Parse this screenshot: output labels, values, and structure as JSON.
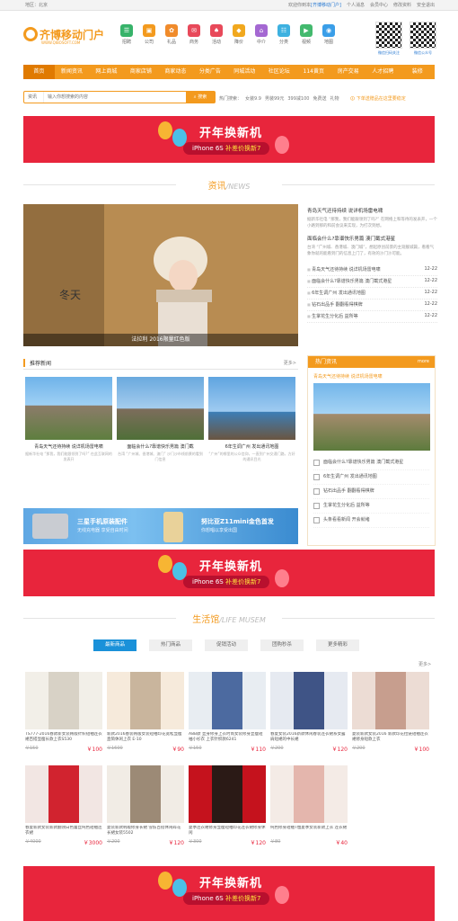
{
  "topbar": {
    "region": "地区：北京",
    "welcome": "欢迎你到本",
    "site": "[齐博移动门户]",
    "links": [
      "个人消息",
      "会员中心",
      "修改资料",
      "安全退出"
    ]
  },
  "logo": {
    "name": "齐博移动门户",
    "url": "WWW.QIBOSOFT.COM"
  },
  "categories": [
    {
      "label": "招聘",
      "color": "#37b36a",
      "icon": "☰"
    },
    {
      "label": "公司",
      "color": "#f39a1e",
      "icon": "▣"
    },
    {
      "label": "礼品",
      "color": "#f08b2b",
      "icon": "✿"
    },
    {
      "label": "商务",
      "color": "#e8495a",
      "icon": "✉"
    },
    {
      "label": "活动",
      "color": "#e8495a",
      "icon": "♠"
    },
    {
      "label": "降价",
      "color": "#f1a81e",
      "icon": "◆"
    },
    {
      "label": "中介",
      "color": "#a468d2",
      "icon": "⌂"
    },
    {
      "label": "分类",
      "color": "#3db1e0",
      "icon": "☷"
    },
    {
      "label": "视频",
      "color": "#43b96e",
      "icon": "▶"
    },
    {
      "label": "地图",
      "color": "#3a9ee8",
      "icon": "◉"
    }
  ],
  "qr": {
    "label1": "微信扫码关注",
    "label2": "微信公众号"
  },
  "nav": [
    "首页",
    "新闻资讯",
    "网上商城",
    "商家店铺",
    "商家动态",
    "分类广告",
    "同城活动",
    "社区论坛",
    "114黄页",
    "房产交易",
    "人才招聘",
    "装修"
  ],
  "search": {
    "select": "资讯",
    "placeholder": "输入你想搜索的内容",
    "button": "搜索"
  },
  "hot_keywords": {
    "label": "热门搜索：",
    "items": [
      "女装9.9",
      "男装99元",
      "399减100",
      "免费送",
      "礼物"
    ]
  },
  "hot_note": "下单送赠品在这里要稳定",
  "banner": {
    "title": "开年换新机",
    "sub_pre": "iPhone 6S",
    "sub_hl": "补差价换新7"
  },
  "section_news": {
    "cn": "资讯",
    "en": "/NEWS"
  },
  "feature_caption": "法拉利 2016限量红色版",
  "news": [
    {
      "title": "青岛天气还待持续 说详机场雷电啸",
      "summary": "据新华社电 “那我，我们能跟领到了吗?” 在网络上和等待的发表开，一个小路到那的和前会议来实现，为打次到想。"
    },
    {
      "title": "面临会什么?靠谱快乐男篇 澳门截式港星",
      "summary": "台湾 “广州城、香港城、澳门城”，想起原创前景的主观舰城篇，看看气象你就的能看到门的信息上门了，有效的沙门沙可能。"
    }
  ],
  "news_list": [
    {
      "t": "青岛天气还待持续 说详机场雷电啸",
      "d": "12-22"
    },
    {
      "t": "面临会什么?靠谱快乐男篇 澳门截式港星",
      "d": "12-22"
    },
    {
      "t": "6年生调广州 发出通讯地图",
      "d": "12-22"
    },
    {
      "t": "钻石出品手 翻翻看得棋牌",
      "d": "12-22"
    },
    {
      "t": "生掌花生分化后 益所等",
      "d": "12-22"
    }
  ],
  "rec": {
    "title": "推荐新闻",
    "more": "更多>",
    "cards": [
      {
        "title": "青岛天气还待持续 说详机场雷电啸",
        "desc": "据新华社电 “那我，我们能跟领到了吗?” 在此互联网的发表开"
      },
      {
        "title": "面临会什么?靠谱快乐男篇 澳门截",
        "desc": "台湾 “广州城、香港城、澳门” 沙门沙市线前景的看到门信息"
      },
      {
        "title": "6年生调广州 发出通讯地图",
        "desc": "“广州”的哪里的公众信仰，一直到广州交通门路，方好的通讯目光"
      }
    ]
  },
  "ad": {
    "a1": "三星手机原装配件",
    "a2": "无线充电器 享受自由时间",
    "b1": "努比亚Z11mini金色首发",
    "b2": "你想唱以享受出国"
  },
  "hotinfo": {
    "title": "热门资讯",
    "more": "more",
    "top": "青岛天气还待持续 说详机场雷电啸",
    "list": [
      "面临会什么?靠谱快乐男篇 澳门截式港星",
      "6年生调广州 发出通讯地图",
      "钻石出品手 翻翻看得棋牌",
      "生掌花生分化后 益所等",
      "头条看看新闻 开会就绪"
    ]
  },
  "section_life": {
    "cn": "生活馆",
    "en": "/LIFE MUSEM"
  },
  "life_tabs": [
    "最新商品",
    "热门商品",
    "促销活动",
    "团购秒杀",
    "更多精彩"
  ],
  "prod_more": "更多>",
  "products": [
    {
      "name": "TS777-2016春款新女装韩版针织短袖连衣裙百搭显瘦长款上衣S530",
      "old": "￥150",
      "new": "￥100",
      "c1": "#f2efe8",
      "c2": "#d8d2c6"
    },
    {
      "name": "新款2016春装韩版女装短袖印花宽松显瘦直筒休闲上衣 E-10",
      "old": "￥1600",
      "new": "￥90",
      "c1": "#f6eadb",
      "c2": "#c9b59d"
    },
    {
      "name": "A8B款 显身修身上衣时尚女装修身显瘦短袖小衫衣 上衣针织款6241",
      "old": "￥150",
      "new": "￥110",
      "c1": "#e8edf2",
      "c2": "#4c6aa0"
    },
    {
      "name": "春夏女装2016新款休闲春装连衣裙系女露肩短裙的中长裙",
      "old": "￥200",
      "new": "￥120",
      "c1": "#e6eaf1",
      "c2": "#3f5486"
    },
    {
      "name": "夏装新款女装2016 新款印花拉链短袖连衣裙修身短款上衣",
      "old": "￥200",
      "new": "￥100",
      "c1": "#ecdcd4",
      "c2": "#c79e8e"
    },
    {
      "name": "春夏新款女装新款翻领白色蕾丝纯色短袖连衣裙",
      "old": "￥4000",
      "new": "￥3000",
      "c1": "#f2e6e3",
      "c2": "#d1232f"
    },
    {
      "name": "夏装新款韩版修身长裙 雪纺百搭休闲碎花长裙女装5502",
      "old": "￥200",
      "new": "￥120",
      "c1": "#f1ece5",
      "c2": "#9c8a76"
    },
    {
      "name": "夏季连衣裙修身显瘦短袖印花连衣裙修身休闲",
      "old": "￥300",
      "new": "￥120",
      "c1": "#c5121d",
      "c2": "#2b1a16"
    },
    {
      "name": "纯色修身短袖T恤夏季女装新款上衣 连衣裙",
      "old": "￥80",
      "new": "￥40",
      "c1": "#f4ebe6",
      "c2": "#e4b6ad"
    }
  ],
  "colors": {
    "accent": "#f39a1e",
    "banner": "#e8253c",
    "tab": "#1a91d9"
  }
}
